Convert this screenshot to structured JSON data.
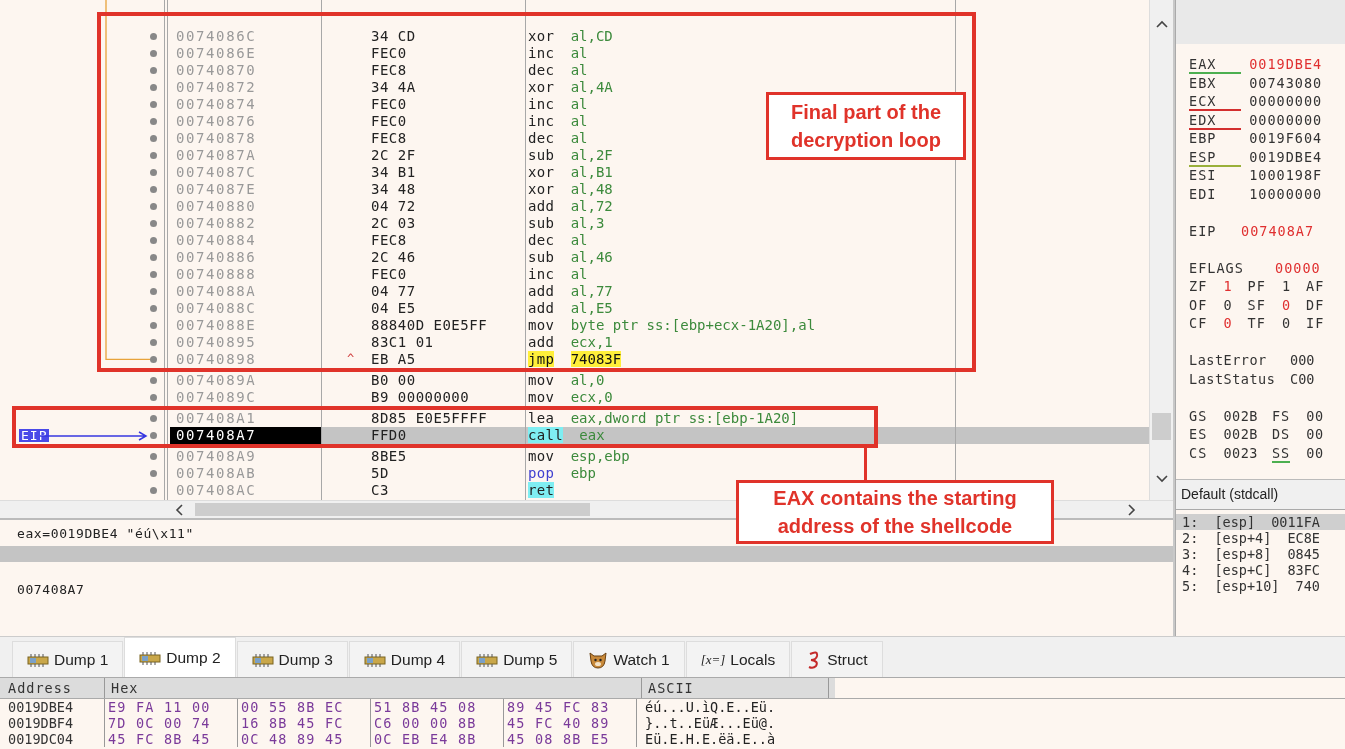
{
  "disassembly": {
    "rows": [
      {
        "address": "0074086C",
        "bytes": "34 CD",
        "mnemonic": "xor",
        "operands": "al,CD",
        "kind": "normal",
        "current": false
      },
      {
        "address": "0074086E",
        "bytes": "FEC0",
        "mnemonic": "inc",
        "operands": "al",
        "kind": "normal",
        "current": false
      },
      {
        "address": "00740870",
        "bytes": "FEC8",
        "mnemonic": "dec",
        "operands": "al",
        "kind": "normal",
        "current": false
      },
      {
        "address": "00740872",
        "bytes": "34 4A",
        "mnemonic": "xor",
        "operands": "al,4A",
        "kind": "normal",
        "current": false
      },
      {
        "address": "00740874",
        "bytes": "FEC0",
        "mnemonic": "inc",
        "operands": "al",
        "kind": "normal",
        "current": false
      },
      {
        "address": "00740876",
        "bytes": "FEC0",
        "mnemonic": "inc",
        "operands": "al",
        "kind": "normal",
        "current": false
      },
      {
        "address": "00740878",
        "bytes": "FEC8",
        "mnemonic": "dec",
        "operands": "al",
        "kind": "normal",
        "current": false
      },
      {
        "address": "0074087A",
        "bytes": "2C 2F",
        "mnemonic": "sub",
        "operands": "al,2F",
        "kind": "normal",
        "current": false
      },
      {
        "address": "0074087C",
        "bytes": "34 B1",
        "mnemonic": "xor",
        "operands": "al,B1",
        "kind": "normal",
        "current": false
      },
      {
        "address": "0074087E",
        "bytes": "34 48",
        "mnemonic": "xor",
        "operands": "al,48",
        "kind": "normal",
        "current": false
      },
      {
        "address": "00740880",
        "bytes": "04 72",
        "mnemonic": "add",
        "operands": "al,72",
        "kind": "normal",
        "current": false
      },
      {
        "address": "00740882",
        "bytes": "2C 03",
        "mnemonic": "sub",
        "operands": "al,3",
        "kind": "normal",
        "current": false
      },
      {
        "address": "00740884",
        "bytes": "FEC8",
        "mnemonic": "dec",
        "operands": "al",
        "kind": "normal",
        "current": false
      },
      {
        "address": "00740886",
        "bytes": "2C 46",
        "mnemonic": "sub",
        "operands": "al,46",
        "kind": "normal",
        "current": false
      },
      {
        "address": "00740888",
        "bytes": "FEC0",
        "mnemonic": "inc",
        "operands": "al",
        "kind": "normal",
        "current": false
      },
      {
        "address": "0074088A",
        "bytes": "04 77",
        "mnemonic": "add",
        "operands": "al,77",
        "kind": "normal",
        "current": false
      },
      {
        "address": "0074088C",
        "bytes": "04 E5",
        "mnemonic": "add",
        "operands": "al,E5",
        "kind": "normal",
        "current": false
      },
      {
        "address": "0074088E",
        "bytes": "88840D E0E5FF",
        "mnemonic": "mov",
        "operands": "byte ptr ss:[ebp+ecx-1A20],al",
        "kind": "normal",
        "current": false
      },
      {
        "address": "00740895",
        "bytes": "83C1 01",
        "mnemonic": "add",
        "operands": "ecx,1",
        "kind": "normal",
        "current": false
      },
      {
        "address": "00740898",
        "bytes": "EB A5",
        "arrow": "^",
        "mnemonic": "jmp",
        "operands": "74083F",
        "kind": "jump",
        "current": false
      },
      {
        "address": "0074089A",
        "bytes": "B0 00",
        "mnemonic": "mov",
        "operands": "al,0",
        "kind": "normal",
        "current": false
      },
      {
        "address": "0074089C",
        "bytes": "B9 00000000",
        "mnemonic": "mov",
        "operands": "ecx,0",
        "kind": "normal",
        "current": false
      },
      {
        "address": "007408A1",
        "bytes": "8D85 E0E5FFFF",
        "mnemonic": "lea",
        "operands": "eax,dword ptr ss:[ebp-1A20]",
        "kind": "normal",
        "current": false
      },
      {
        "address": "007408A7",
        "bytes": "FFD0",
        "mnemonic": "call",
        "operands": "eax",
        "kind": "call",
        "current": true
      },
      {
        "address": "007408A9",
        "bytes": "8BE5",
        "mnemonic": "mov",
        "operands": "esp,ebp",
        "kind": "normal",
        "current": false
      },
      {
        "address": "007408AB",
        "bytes": "5D",
        "mnemonic": "pop",
        "operands": "ebp",
        "kind": "stack",
        "current": false
      },
      {
        "address": "007408AC",
        "bytes": "C3",
        "mnemonic": "ret",
        "operands": "",
        "kind": "ret",
        "current": false
      }
    ],
    "eip_label": "EIP"
  },
  "annotations": [
    {
      "text": "Final part of the decryption loop"
    },
    {
      "text": "EAX contains the starting address of the shellcode"
    }
  ],
  "info": {
    "line_1": "eax=0019DBE4 \"éú\\x11\"",
    "line_2": "007408A7"
  },
  "registers": {
    "general": [
      {
        "name": "EAX",
        "value": "0019DBE4",
        "changed": true,
        "color": "#4caf50"
      },
      {
        "name": "EBX",
        "value": "00743080",
        "changed": false
      },
      {
        "name": "ECX",
        "value": "00000000",
        "changed": false,
        "color": "#d32f2f"
      },
      {
        "name": "EDX",
        "value": "00000000",
        "changed": false,
        "color": "#d32f2f"
      },
      {
        "name": "EBP",
        "value": "0019F604",
        "changed": false
      },
      {
        "name": "ESP",
        "value": "0019DBE4",
        "changed": false,
        "color": "#9ab03a"
      },
      {
        "name": "ESI",
        "value": "1000198F",
        "changed": false
      },
      {
        "name": "EDI",
        "value": "10000000",
        "changed": false
      }
    ],
    "eip": {
      "name": "EIP",
      "value": "007408A7",
      "changed": true
    },
    "eflags": {
      "name": "EFLAGS",
      "value": "00000",
      "changed": true
    },
    "flags": [
      [
        {
          "name": "ZF",
          "value": "1",
          "changed": true
        },
        {
          "name": "PF",
          "value": "1",
          "changed": false
        },
        {
          "name": "AF"
        }
      ],
      [
        {
          "name": "OF",
          "value": "0",
          "changed": false
        },
        {
          "name": "SF",
          "value": "0",
          "changed": true
        },
        {
          "name": "DF"
        }
      ],
      [
        {
          "name": "CF",
          "value": "0",
          "changed": true
        },
        {
          "name": "TF",
          "value": "0",
          "changed": false
        },
        {
          "name": "IF"
        }
      ]
    ],
    "status": [
      {
        "name": "LastError",
        "value": "000"
      },
      {
        "name": "LastStatus",
        "value": "C00"
      }
    ],
    "segments": [
      [
        {
          "name": "GS",
          "value": "002B"
        },
        {
          "name": "FS",
          "value": "00"
        }
      ],
      [
        {
          "name": "ES",
          "value": "002B"
        },
        {
          "name": "DS",
          "value": "00"
        }
      ],
      [
        {
          "name": "CS",
          "value": "0023"
        },
        {
          "name": "SS",
          "value": "00",
          "color": "#4caf50"
        }
      ]
    ]
  },
  "call_convention": "Default (stdcall)",
  "stack_args": [
    {
      "index": "1:",
      "ref": "[esp]",
      "value": "0011FA",
      "selected": true
    },
    {
      "index": "2:",
      "ref": "[esp+4]",
      "value": "EC8E",
      "selected": false
    },
    {
      "index": "3:",
      "ref": "[esp+8]",
      "value": "0845",
      "selected": false
    },
    {
      "index": "4:",
      "ref": "[esp+C]",
      "value": "83FC",
      "selected": false
    },
    {
      "index": "5:",
      "ref": "[esp+10]",
      "value": "740",
      "selected": false
    }
  ],
  "tabs": [
    {
      "label": "Dump 1",
      "kind": "dump",
      "selected": false
    },
    {
      "label": "Dump 2",
      "kind": "dump",
      "selected": true
    },
    {
      "label": "Dump 3",
      "kind": "dump",
      "selected": false
    },
    {
      "label": "Dump 4",
      "kind": "dump",
      "selected": false
    },
    {
      "label": "Dump 5",
      "kind": "dump",
      "selected": false
    },
    {
      "label": "Watch 1",
      "kind": "watch",
      "selected": false
    },
    {
      "label": "Locals",
      "kind": "locals",
      "icon_text": "[x=]",
      "selected": false
    },
    {
      "label": "Struct",
      "kind": "struct",
      "selected": false
    }
  ],
  "dump": {
    "columns": [
      "Address",
      "Hex",
      "ASCII"
    ],
    "rows": [
      {
        "address": "0019DBE4",
        "hex": [
          [
            "E9",
            "FA",
            "11",
            "00"
          ],
          [
            "00",
            "55",
            "8B",
            "EC"
          ],
          [
            "51",
            "8B",
            "45",
            "08"
          ],
          [
            "89",
            "45",
            "FC",
            "83"
          ]
        ],
        "ascii": "éú...U.ìQ.E..Eü."
      },
      {
        "address": "0019DBF4",
        "hex": [
          [
            "7D",
            "0C",
            "00",
            "74"
          ],
          [
            "16",
            "8B",
            "45",
            "FC"
          ],
          [
            "C6",
            "00",
            "00",
            "8B"
          ],
          [
            "45",
            "FC",
            "40",
            "89"
          ]
        ],
        "ascii": "}..t..EüÆ...Eü@."
      },
      {
        "address": "0019DC04",
        "hex": [
          [
            "45",
            "FC",
            "8B",
            "45"
          ],
          [
            "0C",
            "48",
            "89",
            "45"
          ],
          [
            "0C",
            "EB",
            "E4",
            "8B"
          ],
          [
            "45",
            "08",
            "8B",
            "E5"
          ]
        ],
        "ascii": "Eü.E.H.E.ëä.E..à"
      }
    ]
  }
}
